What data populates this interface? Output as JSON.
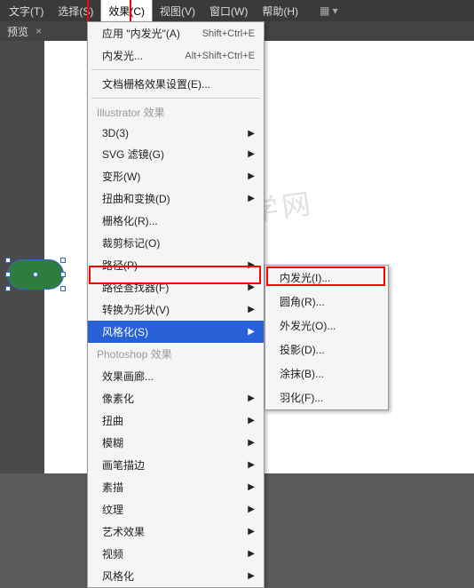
{
  "menubar": {
    "items": [
      {
        "label": "文字(T)"
      },
      {
        "label": "选择(S)"
      },
      {
        "label": "效果(C)",
        "active": true
      },
      {
        "label": "视图(V)"
      },
      {
        "label": "窗口(W)"
      },
      {
        "label": "帮助(H)"
      }
    ]
  },
  "tab": {
    "label": "预览",
    "close": "×"
  },
  "dropdown": {
    "recent": [
      {
        "label": "应用 \"内发光\"(A)",
        "shortcut": "Shift+Ctrl+E"
      },
      {
        "label": "内发光...",
        "shortcut": "Alt+Shift+Ctrl+E"
      }
    ],
    "docgrid": "文档栅格效果设置(E)...",
    "illustrator_header": "Illustrator 效果",
    "illustrator": [
      {
        "label": "3D(3)",
        "arrow": true
      },
      {
        "label": "SVG 滤镜(G)",
        "arrow": true
      },
      {
        "label": "变形(W)",
        "arrow": true
      },
      {
        "label": "扭曲和变换(D)",
        "arrow": true
      },
      {
        "label": "栅格化(R)...",
        "arrow": false
      },
      {
        "label": "裁剪标记(O)",
        "arrow": false
      },
      {
        "label": "路径(P)",
        "arrow": true
      },
      {
        "label": "路径查找器(F)",
        "arrow": true
      },
      {
        "label": "转换为形状(V)",
        "arrow": true
      },
      {
        "label": "风格化(S)",
        "arrow": true,
        "highlighted": true
      }
    ],
    "photoshop_header": "Photoshop 效果",
    "photoshop": [
      {
        "label": "效果画廊...",
        "arrow": false
      },
      {
        "label": "像素化",
        "arrow": true
      },
      {
        "label": "扭曲",
        "arrow": true
      },
      {
        "label": "模糊",
        "arrow": true
      },
      {
        "label": "画笔描边",
        "arrow": true
      },
      {
        "label": "素描",
        "arrow": true
      },
      {
        "label": "纹理",
        "arrow": true
      },
      {
        "label": "艺术效果",
        "arrow": true
      },
      {
        "label": "视频",
        "arrow": true
      },
      {
        "label": "风格化",
        "arrow": true
      }
    ]
  },
  "submenu": {
    "items": [
      {
        "label": "内发光(I)..."
      },
      {
        "label": "圆角(R)..."
      },
      {
        "label": "外发光(O)..."
      },
      {
        "label": "投影(D)..."
      },
      {
        "label": "涂抹(B)..."
      },
      {
        "label": "羽化(F)..."
      }
    ]
  },
  "watermark": "软件自学网"
}
